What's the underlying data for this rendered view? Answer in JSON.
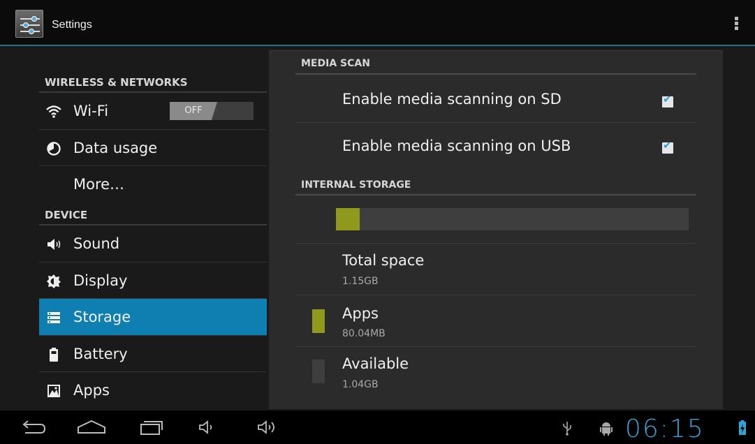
{
  "action_bar": {
    "title": "Settings"
  },
  "sidebar": {
    "sections": [
      {
        "header": "WIRELESS & NETWORKS"
      },
      {
        "header": "DEVICE"
      }
    ],
    "items": [
      {
        "label": "Wi-Fi",
        "icon": "wifi-icon",
        "toggle": "OFF"
      },
      {
        "label": "Data usage",
        "icon": "data-usage-icon"
      },
      {
        "label": "More…"
      },
      {
        "label": "Sound",
        "icon": "speaker-icon"
      },
      {
        "label": "Display",
        "icon": "brightness-icon"
      },
      {
        "label": "Storage",
        "icon": "storage-icon",
        "selected": true
      },
      {
        "label": "Battery",
        "icon": "battery-icon"
      },
      {
        "label": "Apps",
        "icon": "apps-icon"
      }
    ]
  },
  "panel": {
    "media_scan": {
      "header": "MEDIA SCAN",
      "options": [
        {
          "label": "Enable media scanning on SD",
          "checked": true
        },
        {
          "label": "Enable media scanning on USB",
          "checked": true
        }
      ]
    },
    "internal_storage": {
      "header": "INTERNAL STORAGE",
      "used_fraction": 0.068,
      "total": {
        "label": "Total space",
        "value": "1.15GB"
      },
      "apps": {
        "label": "Apps",
        "value": "80.04MB",
        "color": "#8f9a1d"
      },
      "available": {
        "label": "Available",
        "value": "1.04GB",
        "color": "#3e3e3e"
      }
    }
  },
  "system_bar": {
    "clock": "06:15",
    "accent": "#31a5d5"
  },
  "colors": {
    "selected": "#0f7fb2",
    "action_bar_rule": "#2d6f8a"
  }
}
